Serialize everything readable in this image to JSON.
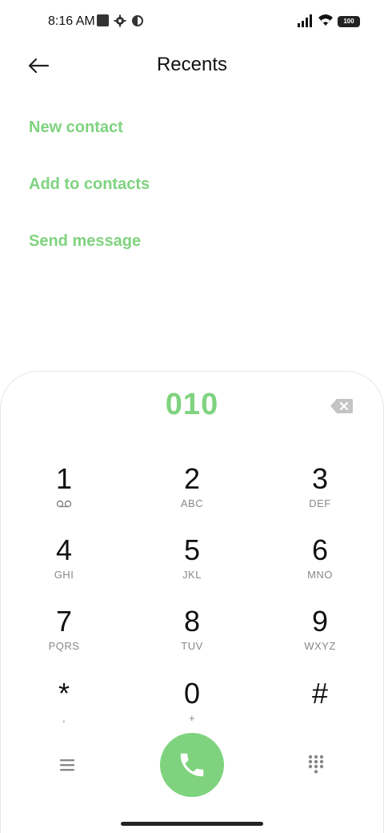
{
  "status_bar": {
    "time": "8:16 AM",
    "battery": "100",
    "icons": [
      "notification-square-icon",
      "settings-gear-icon",
      "data-saver-icon",
      "cell-signal-icon",
      "wifi-icon",
      "battery-icon"
    ]
  },
  "header": {
    "title": "Recents",
    "back_icon": "arrow-left-icon"
  },
  "actions": [
    {
      "label": "New contact"
    },
    {
      "label": "Add to contacts"
    },
    {
      "label": "Send message"
    }
  ],
  "dialer": {
    "number": "010",
    "backspace_icon": "backspace-icon",
    "keys": [
      {
        "digit": "1",
        "letters": "",
        "icon": "voicemail-icon"
      },
      {
        "digit": "2",
        "letters": "ABC"
      },
      {
        "digit": "3",
        "letters": "DEF"
      },
      {
        "digit": "4",
        "letters": "GHI"
      },
      {
        "digit": "5",
        "letters": "JKL"
      },
      {
        "digit": "6",
        "letters": "MNO"
      },
      {
        "digit": "7",
        "letters": "PQRS"
      },
      {
        "digit": "8",
        "letters": "TUV"
      },
      {
        "digit": "9",
        "letters": "WXYZ"
      },
      {
        "digit": "*",
        "letters": ","
      },
      {
        "digit": "0",
        "letters": "+"
      },
      {
        "digit": "#",
        "letters": ""
      }
    ],
    "bottom_icons": [
      "menu-icon",
      "phone-icon",
      "dialpad-icon"
    ]
  },
  "colors": {
    "accent": "#7fd37f",
    "text": "#111111",
    "muted": "#888888"
  }
}
